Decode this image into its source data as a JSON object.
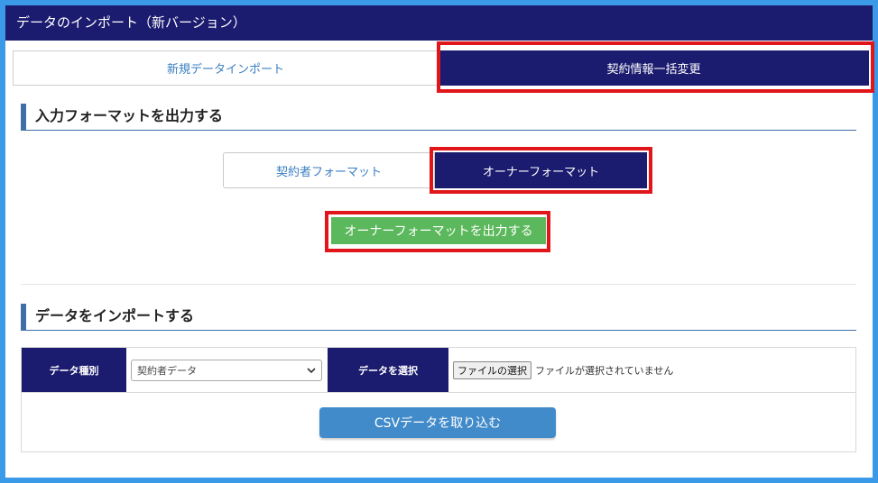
{
  "header": {
    "title": "データのインポート（新バージョン）"
  },
  "tabs": [
    {
      "label": "新規データインポート",
      "active": false
    },
    {
      "label": "契約情報一括変更",
      "active": true
    }
  ],
  "export_section": {
    "title": "入力フォーマットを出力する",
    "formats": [
      {
        "label": "契約者フォーマット",
        "active": false
      },
      {
        "label": "オーナーフォーマット",
        "active": true
      }
    ],
    "export_button": "オーナーフォーマットを出力する"
  },
  "import_section": {
    "title": "データをインポートする",
    "type_label": "データ種別",
    "type_value": "契約者データ",
    "select_label": "データを選択",
    "file_button": "ファイルの選択",
    "file_status": "ファイルが選択されていません",
    "csv_button": "CSVデータを取り込む"
  },
  "colors": {
    "navy": "#1b1b6f",
    "green": "#5cb85c",
    "blue": "#428bca",
    "highlight": "#e0161b"
  }
}
